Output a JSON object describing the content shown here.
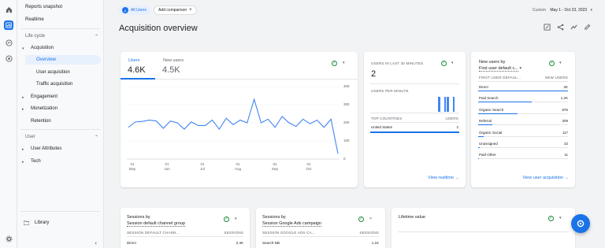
{
  "topbar": {
    "audience_chip": "All Users",
    "audience_chip_letter": "A",
    "add_comparison": "Add comparison",
    "custom_label": "Custom",
    "date_range": "May 1 - Oct 23, 2023"
  },
  "page_title": "Acquisition overview",
  "nav": {
    "reports_snapshot": "Reports snapshot",
    "realtime": "Realtime",
    "life_cycle": "Life cycle",
    "acquisition": "Acquisition",
    "overview": "Overview",
    "user_acquisition": "User acquisition",
    "traffic_acquisition": "Traffic acquisition",
    "engagement": "Engagement",
    "monetization": "Monetization",
    "retention": "Retention",
    "user_section": "User",
    "user_attributes": "User Attributes",
    "tech": "Tech",
    "library": "Library"
  },
  "main_card": {
    "tab1_label": "Users",
    "tab1_value": "4.6K",
    "tab2_label": "New users",
    "tab2_value": "4.5K",
    "y_ticks": [
      "400",
      "300",
      "200",
      "100",
      "0"
    ],
    "x_ticks": [
      {
        "top": "01",
        "bottom": "May"
      },
      {
        "top": "01",
        "bottom": "Jun"
      },
      {
        "top": "01",
        "bottom": "Jul"
      },
      {
        "top": "01",
        "bottom": "Aug"
      },
      {
        "top": "01",
        "bottom": "Sep"
      },
      {
        "top": "01",
        "bottom": "Oct"
      }
    ]
  },
  "chart_data": {
    "type": "line",
    "title": "",
    "xlabel": "",
    "ylabel": "",
    "ylim": [
      0,
      400
    ],
    "series": [
      {
        "name": "Users",
        "values": [
          175,
          205,
          208,
          215,
          210,
          170,
          210,
          200,
          165,
          205,
          185,
          185,
          215,
          165,
          225,
          190,
          215,
          200,
          330,
          200,
          220,
          175,
          235,
          200,
          180,
          220,
          195,
          215,
          175,
          220,
          30
        ]
      }
    ],
    "x_ticks": [
      "01 May",
      "01 Jun",
      "01 Jul",
      "01 Aug",
      "01 Sep",
      "01 Oct"
    ],
    "grid": true
  },
  "realtime_card": {
    "title": "USERS IN LAST 30 MINUTES",
    "value": "2",
    "per_minute": "USERS PER MINUTE",
    "per_minute_bars": [
      0,
      0,
      0,
      0,
      0,
      0,
      0,
      0,
      0,
      0,
      0,
      0,
      0,
      0,
      0,
      0,
      0,
      0,
      0,
      0,
      0,
      0,
      0,
      1,
      0,
      1,
      1,
      0,
      1,
      0
    ],
    "col1": "TOP COUNTRIES",
    "col2": "USERS",
    "rows": [
      {
        "name": "United States",
        "value": "2"
      }
    ],
    "link": "View realtime"
  },
  "newusers_card": {
    "title_line1": "New users by",
    "title_line2": "First user default c...",
    "col1": "FIRST USER DEFAUL...",
    "col2": "NEW USERS",
    "rows": [
      {
        "name": "Direct",
        "value": "2K"
      },
      {
        "name": "Paid Search",
        "value": "1.2K"
      },
      {
        "name": "Organic Search",
        "value": "876"
      },
      {
        "name": "Referral",
        "value": "309"
      },
      {
        "name": "Organic Social",
        "value": "117"
      },
      {
        "name": "Unassigned",
        "value": "32"
      },
      {
        "name": "Paid Other",
        "value": "11"
      }
    ],
    "link": "View user acquisition"
  },
  "sessions_card1": {
    "title_line1": "Sessions by",
    "title_line2": "Session default channel group",
    "col1": "SESSION DEFAULT CHANN...",
    "col2": "SESSIONS",
    "row_name": "Direct",
    "row_value": "2.4K"
  },
  "sessions_card2": {
    "title_line1": "Sessions by",
    "title_line2": "Session Google Ads campaign",
    "col1": "SESSION GOOGLE ADS CA...",
    "col2": "SESSIONS",
    "row_name": "Search-NB",
    "row_value": "1.1K"
  },
  "lifetime_card": {
    "title": "Lifetime value"
  },
  "colors": {
    "accent": "#1a73e8",
    "check": "#1e8e3e"
  }
}
